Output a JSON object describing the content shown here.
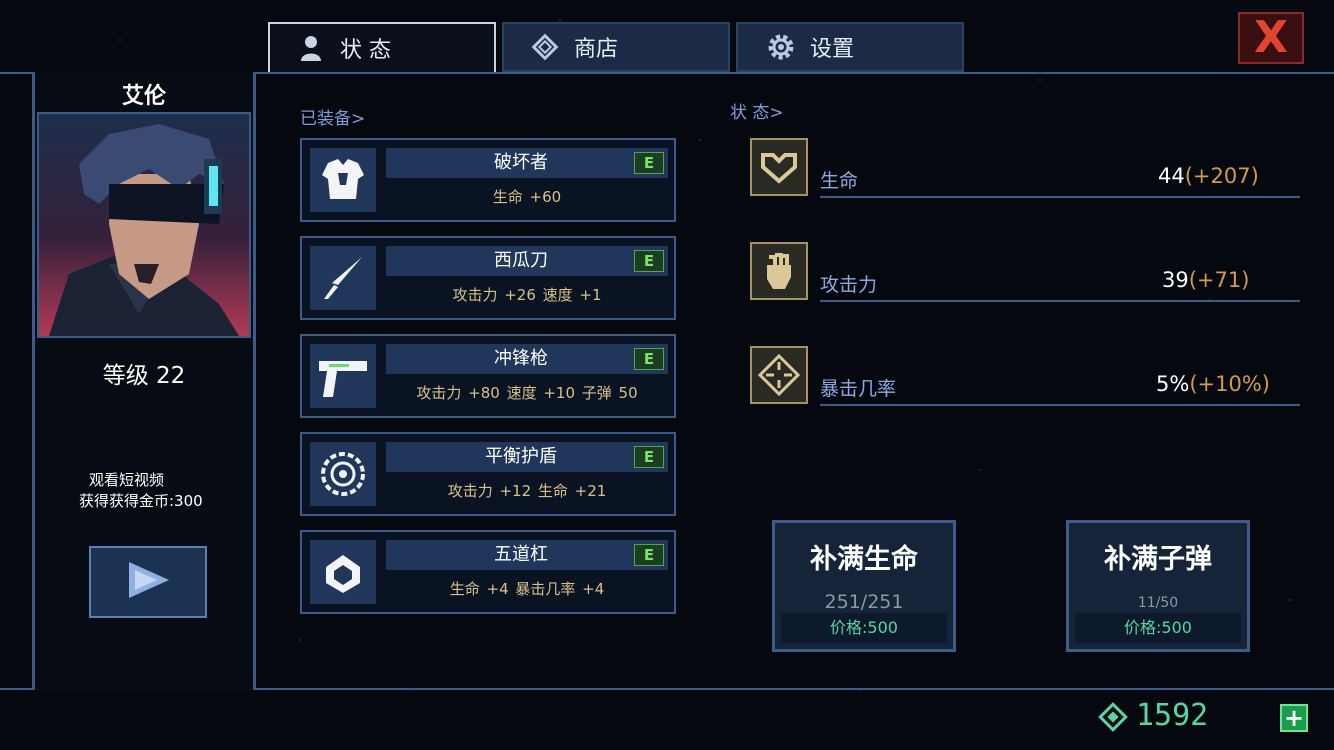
{
  "tabs": [
    {
      "label": "状 态",
      "icon": "person-icon"
    },
    {
      "label": "商店",
      "icon": "diamond-icon"
    },
    {
      "label": "设置",
      "icon": "gear-icon"
    }
  ],
  "close_label": "X",
  "hero": {
    "name": "艾伦",
    "level": "等级 22",
    "video_line1": "观看短视频",
    "video_line2": "获得获得金币:300"
  },
  "equipped_label": "已装备>",
  "items": [
    {
      "name": "破坏者",
      "grade": "E",
      "stats": "生命 +60",
      "icon": "armor-icon"
    },
    {
      "name": "西瓜刀",
      "grade": "E",
      "stats": "攻击力 +26    速度 +1",
      "icon": "knife-icon"
    },
    {
      "name": "冲锋枪",
      "grade": "E",
      "stats": "攻击力 +80    速度 +10    子弹 50",
      "icon": "gun-icon"
    },
    {
      "name": "平衡护盾",
      "grade": "E",
      "stats": "攻击力 +12    生命 +21",
      "icon": "shield-icon"
    },
    {
      "name": "五道杠",
      "grade": "E",
      "stats": "生命 +4    暴击几率 +4",
      "icon": "ring-icon"
    }
  ],
  "status_label": "状 态>",
  "stats": [
    {
      "name": "生命",
      "base": "44",
      "bonus": "(+207)",
      "icon": "heart-icon"
    },
    {
      "name": "攻击力",
      "base": "39",
      "bonus": "(+71)",
      "icon": "fist-icon"
    },
    {
      "name": "暴击几率",
      "base": "5%",
      "bonus": "(+10%)",
      "icon": "crosshair-icon"
    }
  ],
  "refill": [
    {
      "title": "补满生命",
      "amount": "251/251",
      "price": "价格:500"
    },
    {
      "title": "补满子弹",
      "amount": "11/50",
      "price": "价格:500"
    }
  ],
  "currency": "1592",
  "colors": {
    "accent": "#55d6a4",
    "border": "#3b5c86",
    "bonus": "#d19a4a",
    "close": "#e0462e"
  }
}
